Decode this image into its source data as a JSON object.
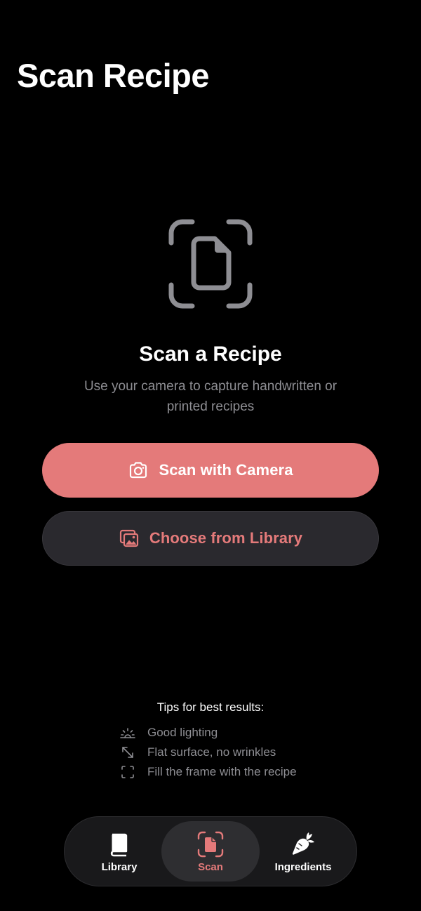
{
  "page": {
    "title": "Scan Recipe"
  },
  "hero": {
    "icon": "document-scan-icon",
    "title": "Scan a Recipe",
    "subtitle": "Use your camera to capture handwritten or printed recipes"
  },
  "actions": {
    "scan_camera": {
      "label": "Scan with Camera",
      "icon": "camera-icon"
    },
    "choose_library": {
      "label": "Choose from Library",
      "icon": "photo-library-icon"
    }
  },
  "tips": {
    "heading": "Tips for best results:",
    "items": [
      {
        "label": "Good lighting",
        "icon": "sun-horizon-icon"
      },
      {
        "label": "Flat surface, no wrinkles",
        "icon": "expand-arrows-icon"
      },
      {
        "label": "Fill the frame with the recipe",
        "icon": "viewfinder-icon"
      }
    ]
  },
  "tab_bar": {
    "active": "Scan",
    "items": [
      {
        "label": "Library",
        "icon": "book-icon"
      },
      {
        "label": "Scan",
        "icon": "document-scan-icon"
      },
      {
        "label": "Ingredients",
        "icon": "carrot-icon"
      }
    ]
  },
  "colors": {
    "background": "#000000",
    "accent": "#e47a7a",
    "secondary_button": "#2a292e",
    "muted_text": "#8e8e93",
    "tab_bar": "#19191b"
  }
}
